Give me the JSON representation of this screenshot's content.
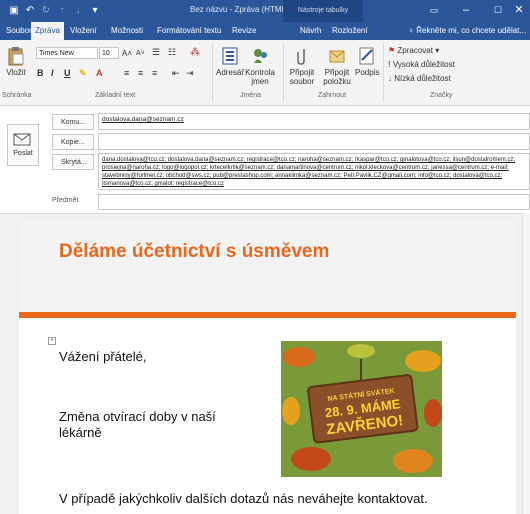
{
  "titlebar": {
    "title": "Bez názvu - Zpráva (HTML)",
    "tool_context": "Nástroje tabulky"
  },
  "tabs": [
    "Soubor",
    "Zpráva",
    "Vložení",
    "Možnosti",
    "Formátování textu",
    "Revize",
    "Návrh",
    "Rozložení"
  ],
  "tellme": "Řekněte mi, co chcete udělat...",
  "ribbon": {
    "paste_label": "Vložit",
    "font_name": "Times New",
    "font_size": "10",
    "attach_label": "Adresář",
    "check_label": "Kontrola jmen",
    "attach_file": "Připojit soubor",
    "attach_item": "Připojit položku",
    "signature": "Podpis",
    "followup": "Zpracovat",
    "high": "Vysoká důležitost",
    "low": "Nízká důležitost",
    "group_clipboard": "Schránka",
    "group_basic": "Základní text",
    "group_names": "Jména",
    "group_include": "Zahrnout",
    "group_tags": "Značky"
  },
  "header": {
    "send_label": "Poslat",
    "to_label": "Komu...",
    "cc_label": "Kopie...",
    "bcc_label": "Skrytá...",
    "subject_label": "Předmět",
    "to_value": "dostalova.dana@seznam.cz",
    "cc_value": "",
    "bcc_value": "dana.dostalova@tco.cz; dostalova.dana@seznam.cz; registrace@tco.cz; naroha@seznam.cz; rkaspar@tco.cz; gmalotova@tco.cz; ilsun@dostalromem.cz; prosiejna@naroha.cz; logo@logopol.cz; krtecelkrtik@seznam.cz; danamartinova@centrum.cz; nikol.kleckova@centrum.cz; janessa@centrum.cz; e-mail: stavebniny@forlmel.cz; obchod@sws.cz; pub@prestashop.com; annaklimka@seznam.cz; Petr.Pavlik.CZ@gmail.com; info@tco.cz; dostalova@tco.cz; itsmanova@tco.cz; gmalot: registrace@tco.cz",
    "subject_value": ""
  },
  "body": {
    "headline": "Děláme účetnictví s úsměvem",
    "greeting": "Vážení přátelé,",
    "change_line": "Změna otvírací doby v naší lékárně",
    "contact_line": "V případě jakýchkoliv dalších dotazů nás neváhejte kontaktovat.",
    "sign_top": "NA STÁTNÍ SVÁTEK",
    "sign_mid": "28. 9. MÁME",
    "sign_bottom": "ZAVŘENO!"
  },
  "colors": {
    "brand": "#2b579a",
    "accent": "#e8671c",
    "sign_bg": "#8b4f2a",
    "sign_text": "#ffd23a"
  }
}
